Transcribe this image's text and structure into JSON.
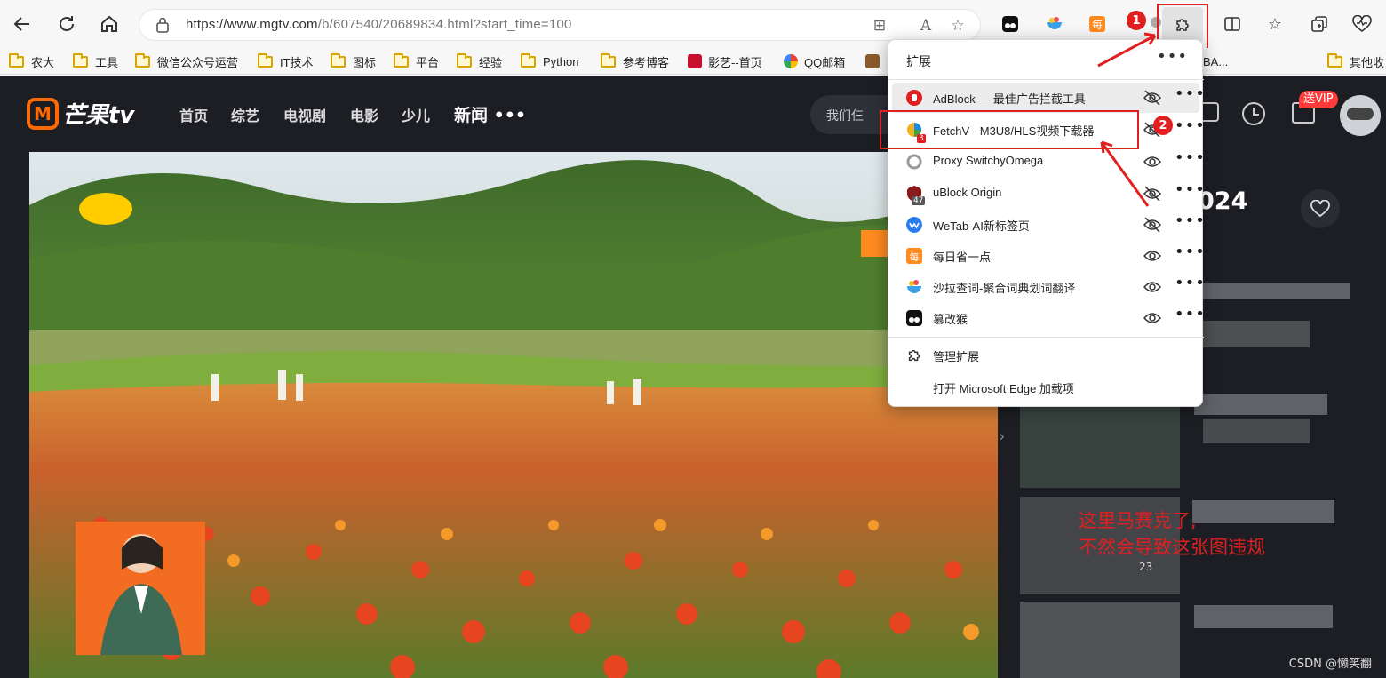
{
  "browser": {
    "url_main": "https://www.mgtv.com",
    "url_rest": "/b/607540/20689834.html?start_time=100"
  },
  "bookmarks": [
    {
      "label": "农大",
      "kind": "folder"
    },
    {
      "label": "工具",
      "kind": "folder"
    },
    {
      "label": "微信公众号运营",
      "kind": "folder"
    },
    {
      "label": "IT技术",
      "kind": "folder"
    },
    {
      "label": "图标",
      "kind": "folder"
    },
    {
      "label": "平台",
      "kind": "folder"
    },
    {
      "label": "经验",
      "kind": "folder"
    },
    {
      "label": "Python",
      "kind": "folder"
    },
    {
      "label": "参考博客",
      "kind": "folder"
    },
    {
      "label": "影艺--首页",
      "kind": "site"
    },
    {
      "label": "QQ邮箱",
      "kind": "site"
    },
    {
      "label": "BA...",
      "kind": "site"
    },
    {
      "label": "其他收",
      "kind": "folder"
    }
  ],
  "site": {
    "logo_text": "芒果tv",
    "nav": [
      "首页",
      "综艺",
      "电视剧",
      "电影",
      "少儿",
      "新闻 •••"
    ],
    "search_text": "我们仨",
    "vip_badge": "送VIP",
    "year_text": "024",
    "counter_text": "23",
    "side_arrow": "›"
  },
  "extensions_menu": {
    "title": "扩展",
    "more": "•••",
    "items": [
      {
        "name": "AdBlock — 最佳广告拦截工具",
        "visible": false,
        "color": "#e02020"
      },
      {
        "name": "FetchV - M3U8/HLS视频下载器",
        "visible": false,
        "color": "#1e88e5",
        "badge": "3"
      },
      {
        "name": "Proxy SwitchyOmega",
        "visible": true,
        "color": "#999999"
      },
      {
        "name": "uBlock Origin",
        "visible": false,
        "color": "#8b1a1a",
        "badge": "47"
      },
      {
        "name": "WeTab-AI新标签页",
        "visible": false,
        "color": "#2a7df0"
      },
      {
        "name": "每日省一点",
        "visible": true,
        "color": "#ff8a1f"
      },
      {
        "name": "沙拉查词-聚合词典划词翻译",
        "visible": true,
        "color": "#3aa0e8"
      },
      {
        "name": "篡改猴",
        "visible": true,
        "color": "#111111"
      }
    ],
    "manage": "管理扩展",
    "open_addons": "打开 Microsoft Edge 加载项"
  },
  "annotations": {
    "num1": "1",
    "num2": "2",
    "note_line1": "这里马赛克了,",
    "note_line2": "不然会导致这张图违规"
  },
  "watermark": "CSDN @懒笑翻"
}
